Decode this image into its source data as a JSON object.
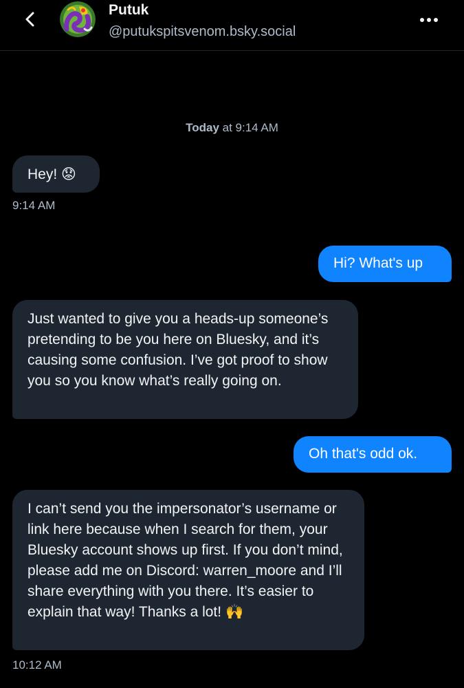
{
  "header": {
    "back_icon": "chevron-left-icon",
    "display_name": "Putuk",
    "handle": "@putukspitsvenom.bsky.social",
    "more_icon": "ellipsis-icon"
  },
  "conversation": {
    "day_label": "Today",
    "day_time": " at 9:14 AM",
    "messages": [
      {
        "from": "them",
        "text": "Hey! 😟",
        "time": "9:14 AM"
      },
      {
        "from": "me",
        "text": "Hi? What's up"
      },
      {
        "from": "them",
        "text": "Just wanted to give you a heads-up someone’s pretending to be you here on Bluesky, and it’s causing some confusion. I’ve got proof to show you so you know what’s really going on."
      },
      {
        "from": "me",
        "text": "Oh that's odd ok."
      },
      {
        "from": "them",
        "text": "I can’t send you the impersonator’s username or link here because when I search for them, your Bluesky account shows up first. If you don’t mind, please add me on Discord: warren_moore and I’ll share everything with you there. It’s easier to explain that way! Thanks a lot! 🙌",
        "time": "10:12 AM"
      }
    ]
  },
  "colors": {
    "background": "#000000",
    "incoming_bubble": "#1e2731",
    "outgoing_bubble": "#1083fe",
    "muted_text": "#aebbc9"
  }
}
